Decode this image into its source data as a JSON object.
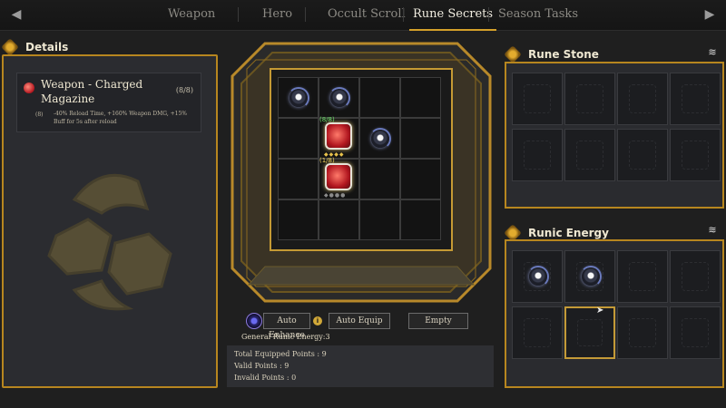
{
  "tabs": [
    {
      "label": "Weapon"
    },
    {
      "label": "Hero"
    },
    {
      "label": "Occult Scroll"
    },
    {
      "label": "Rune Secrets"
    },
    {
      "label": "Season Tasks"
    }
  ],
  "active_tab": "Rune Secrets",
  "nav": {
    "prev_icon": "◀",
    "next_icon": "▶"
  },
  "details": {
    "title": "Details",
    "item_name": "Weapon - Charged Magazine",
    "count": "(8/8)",
    "bullet": "(8)",
    "description": "-40% Reload Time, +160% Weapon DMG, +15% Buff for 5s after reload"
  },
  "grid": {
    "cells": [
      {
        "kind": "orb"
      },
      {
        "kind": "orb"
      },
      {
        "kind": "empty"
      },
      {
        "kind": "empty"
      },
      {
        "kind": "empty"
      },
      {
        "kind": "rune",
        "level": "(8/8)",
        "stars": "◆◆◆◆",
        "level_color": "green"
      },
      {
        "kind": "orb"
      },
      {
        "kind": "empty"
      },
      {
        "kind": "empty"
      },
      {
        "kind": "rune",
        "level": "(1/8)",
        "stars": "◆●●●",
        "level_color": "gold"
      },
      {
        "kind": "empty"
      },
      {
        "kind": "empty"
      },
      {
        "kind": "empty"
      },
      {
        "kind": "empty"
      },
      {
        "kind": "empty"
      },
      {
        "kind": "empty"
      }
    ]
  },
  "actions": {
    "auto_enhance": "Auto Enhance",
    "info_badge": "i",
    "auto_equip": "Auto Equip",
    "empty": "Empty"
  },
  "runic_energy_label": "General Runic Energy:3",
  "points": {
    "total": "Total Equipped Points : 9",
    "valid": "Valid Points : 9",
    "invalid": "Invalid Points : 0"
  },
  "rune_stone": {
    "title": "Rune Stone",
    "layers_icon": "≋"
  },
  "runic_energy": {
    "title": "Runic Energy",
    "layers_icon": "≋"
  },
  "cursor_icon": "➤",
  "colors": {
    "accent_gold": "#b7861f",
    "tab_underline": "#d4a02a",
    "background": "#1f1f1f"
  }
}
